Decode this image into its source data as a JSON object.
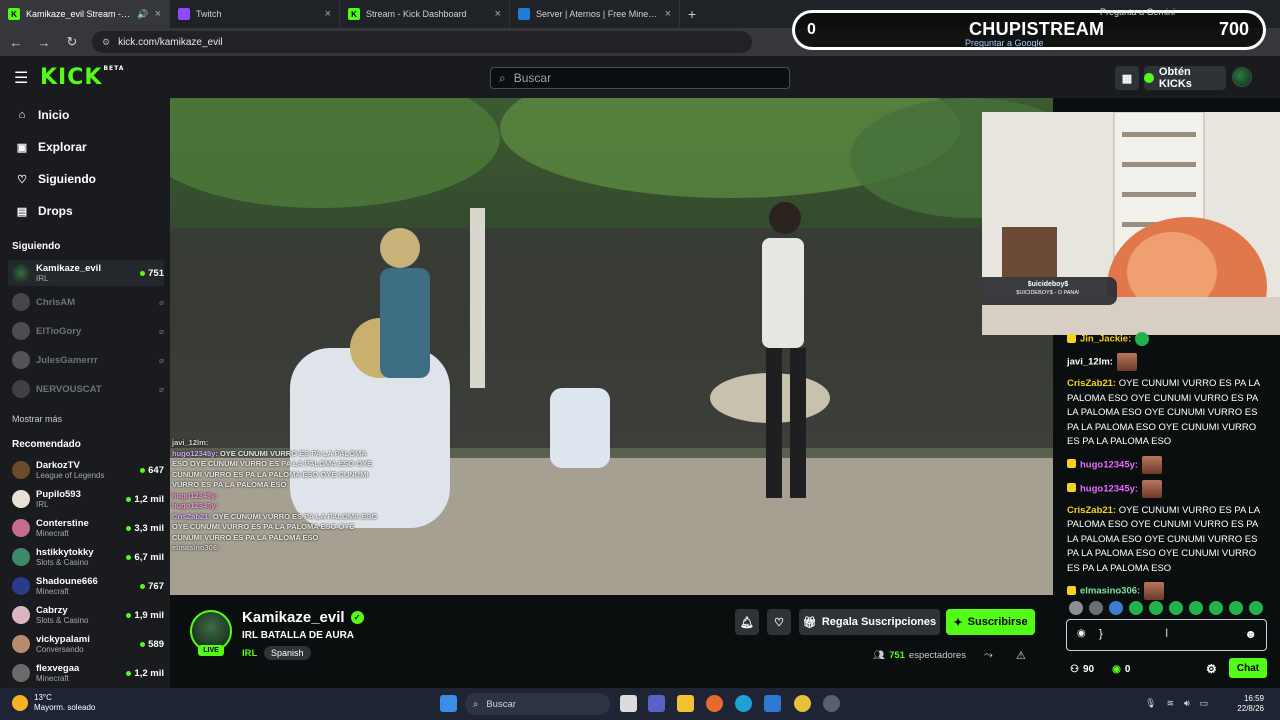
{
  "browser": {
    "tabs": [
      {
        "title": "Kamikaze_evil Stream - Wat",
        "color": "#53fc18",
        "letter": "K"
      },
      {
        "title": "Twitch",
        "color": "#9146ff",
        "letter": ""
      },
      {
        "title": "Stream - Kick Dashboard",
        "color": "#53fc18",
        "letter": "K"
      },
      {
        "title": "Server | Aternos | Free Minecraf",
        "color": "#1c7ed6",
        "letter": ""
      }
    ],
    "url": "kick.com/kamikaze_evil"
  },
  "overlay": {
    "left_value": "0",
    "title": "CHUPISTREAM",
    "right_value": "700",
    "sub": "Preguntar a Google",
    "gemini": "Pregunta a Gemini"
  },
  "header": {
    "logo": "KICK",
    "logo_badge": "BETA",
    "search_placeholder": "Buscar",
    "kicks_label": "Obtén KICKs"
  },
  "sidebar": {
    "nav": [
      {
        "label": "Inicio",
        "icon": "home-icon"
      },
      {
        "label": "Explorar",
        "icon": "browse-icon"
      },
      {
        "label": "Siguiendo",
        "icon": "heart-icon"
      },
      {
        "label": "Drops",
        "icon": "drops-icon"
      }
    ],
    "following_title": "Siguiendo",
    "following": [
      {
        "name": "Kamikaze_evil",
        "category": "IRL",
        "viewers": "751",
        "live": true
      },
      {
        "name": "ChrisAM",
        "live": false
      },
      {
        "name": "ElTioGory",
        "live": false
      },
      {
        "name": "JulesGamerrr",
        "live": false
      },
      {
        "name": "NERVOUSCAT",
        "live": false
      }
    ],
    "more_label": "Mostrar más",
    "recommended_title": "Recomendado",
    "recommended": [
      {
        "name": "DarkozTV",
        "category": "League of Legends",
        "viewers": "647"
      },
      {
        "name": "Pupilo593",
        "category": "IRL",
        "viewers": "1,2 mil"
      },
      {
        "name": "Conterstine",
        "category": "Minecraft",
        "viewers": "3,3 mil"
      },
      {
        "name": "hstikkytokky",
        "category": "Slots & Casino",
        "viewers": "6,7 mil"
      },
      {
        "name": "Shadoune666",
        "category": "Minecraft",
        "viewers": "767"
      },
      {
        "name": "Cabrzy",
        "category": "Slots & Casino",
        "viewers": "1,9 mil"
      },
      {
        "name": "vickypalami",
        "category": "Conversando",
        "viewers": "589"
      },
      {
        "name": "flexvegaa",
        "category": "Minecraft",
        "viewers": "1,2 mil"
      }
    ]
  },
  "video_chat": [
    {
      "user": "javi_12lm:",
      "text": ""
    },
    {
      "user": "hugo12345y:",
      "text": "OYE CUNUMI VURRO ES PA LA PALOMA ESO OYE CUNUMI VURRO ES PA LA PALOMA ESO OYE CUNUMI VURRO ES PA LA PALOMA ESO OYE CUNUMI VURRO ES PA LA PALOMA ESO"
    },
    {
      "user": "hugo12345y:",
      "text": ""
    },
    {
      "user": "hugo12345y:",
      "text": ""
    },
    {
      "user": "CrisZab21:",
      "text": "OYE CUNUMI VURRO ES PA LA PALOMA ESO OYE CUNUMI VURRO ES PA LA PALOMA ESO OYE CUNUMI VURRO ES PA LA PALOMA ESO"
    },
    {
      "user": "elmasino306:",
      "text": ""
    }
  ],
  "stream": {
    "name": "Kamikaze_evil",
    "title": "IRL BATALLA DE AURA",
    "category": "IRL",
    "language": "Spanish",
    "live_label": "LIVE",
    "gift_label": "Regala Suscripciones",
    "subscribe_label": "Suscribirse",
    "viewers": "751",
    "viewers_label": "espectadores"
  },
  "webcam_overlay": {
    "song": "$uicideboy$",
    "artist": "$UICIDEBOY$ - O PANA!"
  },
  "chat": {
    "messages": [
      {
        "user": "Jin_Jackie:",
        "color": "#f2d21b",
        "badge": true,
        "text": "",
        "emote": true
      },
      {
        "user": "javi_12lm:",
        "color": "#ffffff",
        "badge": false,
        "text": "",
        "emote": true
      },
      {
        "user": "CrisZab21:",
        "color": "#f2d21b",
        "badge": false,
        "text": "OYE CUNUMI VURRO ES PA LA PALOMA ESO OYE CUNUMI VURRO ES PA LA PALOMA ESO OYE CUNUMI VURRO ES PA LA PALOMA ESO OYE CUNUMI VURRO ES PA LA PALOMA ESO",
        "emote": false
      },
      {
        "user": "hugo12345y:",
        "color": "#e868ff",
        "badge": true,
        "text": "",
        "emote": true
      },
      {
        "user": "hugo12345y:",
        "color": "#e868ff",
        "badge": true,
        "text": "",
        "emote": true
      },
      {
        "user": "CrisZab21:",
        "color": "#f2d21b",
        "badge": false,
        "text": "OYE CUNUMI VURRO ES PA LA PALOMA ESO OYE CUNUMI VURRO ES PA LA PALOMA ESO OYE CUNUMI VURRO ES PA LA PALOMA ESO OYE CUNUMI VURRO ES PA LA PALOMA ESO",
        "emote": false
      },
      {
        "user": "elmasino306:",
        "color": "#7fe3a4",
        "badge": true,
        "text": "",
        "emote": true
      }
    ],
    "input_value": "}",
    "points": "90",
    "kicks": "0",
    "send_label": "Chat"
  },
  "taskbar": {
    "temp": "13°C",
    "weather": "Mayorm. soleado",
    "search_placeholder": "Buscar",
    "time": "16:59",
    "date": "22/8/26"
  }
}
